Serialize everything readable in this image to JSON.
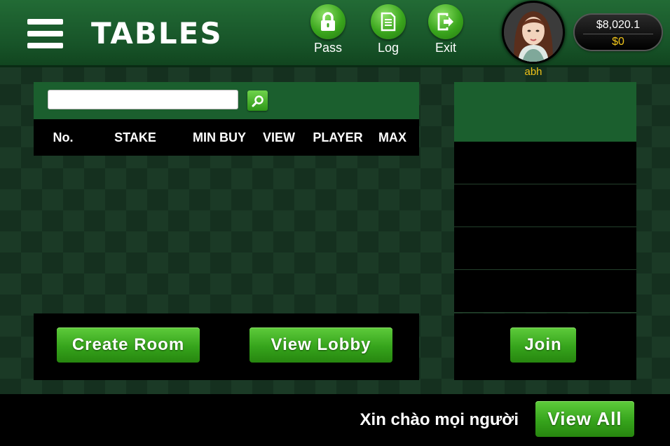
{
  "header": {
    "title": "TABLES",
    "buttons": [
      {
        "label": "Pass",
        "icon": "lock-icon"
      },
      {
        "label": "Log",
        "icon": "document-icon"
      },
      {
        "label": "Exit",
        "icon": "exit-icon"
      }
    ],
    "user": {
      "name": "abh",
      "money": "$8,020.1",
      "chips": "$0"
    }
  },
  "search": {
    "value": "",
    "placeholder": ""
  },
  "table": {
    "columns": [
      "No.",
      "STAKE",
      "MIN BUY",
      "VIEW",
      "PLAYER",
      "MAX"
    ],
    "rows": []
  },
  "actions": {
    "create_room": "Create Room",
    "view_lobby": "View Lobby",
    "join": "Join"
  },
  "footer": {
    "greeting": "Xin chào mọi người",
    "view_all": "View All"
  },
  "colors": {
    "header_green": "#1b5f2e",
    "button_green": "#36a41c",
    "gold": "#f0c419"
  }
}
